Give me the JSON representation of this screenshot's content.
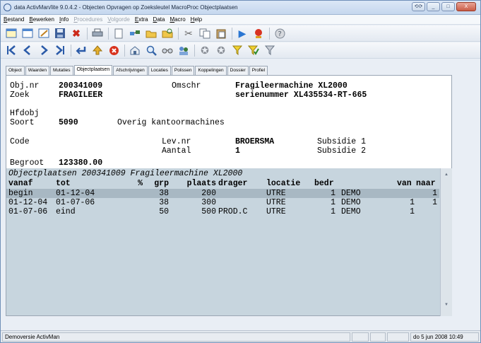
{
  "window": {
    "title": "data ActivMan/lite 9.0.4.2 - Objecten Opvragen op Zoeksleutel MacroProc Objectplaatsen",
    "buttons": [
      "restore",
      "minimize",
      "maximize",
      "close"
    ]
  },
  "menu": [
    {
      "label": "Bestand",
      "enabled": true
    },
    {
      "label": "Bewerken",
      "enabled": true
    },
    {
      "label": "Info",
      "enabled": true
    },
    {
      "label": "Procedures",
      "enabled": false
    },
    {
      "label": "Volgorde",
      "enabled": false
    },
    {
      "label": "Extra",
      "enabled": true
    },
    {
      "label": "Data",
      "enabled": true
    },
    {
      "label": "Macro",
      "enabled": true
    },
    {
      "label": "Help",
      "enabled": true
    }
  ],
  "toolbar1": [
    "new-icon",
    "window-icon",
    "edit-icon",
    "save-icon",
    "delete-icon",
    "print-icon",
    "blank-page-icon",
    "network-icon",
    "open-folder-icon",
    "folder-refresh-icon",
    "cut-icon",
    "copy-icon",
    "paste-icon",
    "play-icon",
    "record-icon",
    "help-icon"
  ],
  "toolbar2": [
    "first-icon",
    "previous-icon",
    "next-icon",
    "last-icon",
    "return-icon",
    "up-icon",
    "cancel-icon",
    "home-icon",
    "search-icon",
    "glasses-icon",
    "find-users-icon",
    "star-icon",
    "star-outline-icon",
    "filter-icon",
    "filter-check-icon",
    "filter-off-icon"
  ],
  "tabs": [
    "Object",
    "Waarden",
    "Mutaties",
    "Objectplaatsen",
    "Afschrijvingen",
    "Locaties",
    "Polissen",
    "Koppelingen",
    "Dossier",
    "Profiel"
  ],
  "active_tab": "Objectplaatsen",
  "form": {
    "objnr_label": "Obj.nr",
    "objnr_value": "200341009",
    "omschr_label": "Omschr",
    "omschr_value": "Fragileermachine XL2000",
    "zoek_label": "Zoek",
    "zoek_value": "FRAGILEER",
    "omschr_value2": "serienummer XL435534-RT-665",
    "hfdobj_label": "Hfdobj",
    "soort_label": "Soort",
    "soort_code": "5090",
    "soort_desc": "Overig kantoormachines",
    "code_label": "Code",
    "levnr_label": "Lev.nr",
    "levnr_value": "BROERSMA",
    "subsidie1_label": "Subsidie 1",
    "aantal_label": "Aantal",
    "aantal_value": "1",
    "subsidie2_label": "Subsidie 2",
    "begroot_label": "Begroot",
    "begroot_value": "123380.00"
  },
  "grid": {
    "title": "Objectplaatsen 200341009 Fragileermachine XL2000",
    "headers": [
      "vanaf",
      "tot",
      "%",
      "grp",
      "plaats",
      "drager",
      "locatie",
      "bedr",
      "van",
      "naar"
    ],
    "rows": [
      [
        "begin",
        "01-12-04",
        "",
        "38",
        "200",
        "",
        "UTRE",
        "1",
        "DEMO",
        "",
        "1"
      ],
      [
        "01-12-04",
        "01-07-06",
        "",
        "38",
        "300",
        "",
        "UTRE",
        "1",
        "DEMO",
        "1",
        "1"
      ],
      [
        "01-07-06",
        "eind",
        "",
        "50",
        "500",
        "PROD.C",
        "UTRE",
        "1",
        "DEMO",
        "1",
        ""
      ]
    ]
  },
  "status": {
    "left": "Demoversie ActivMan",
    "right": "do 5 jun 2008 10:49"
  }
}
